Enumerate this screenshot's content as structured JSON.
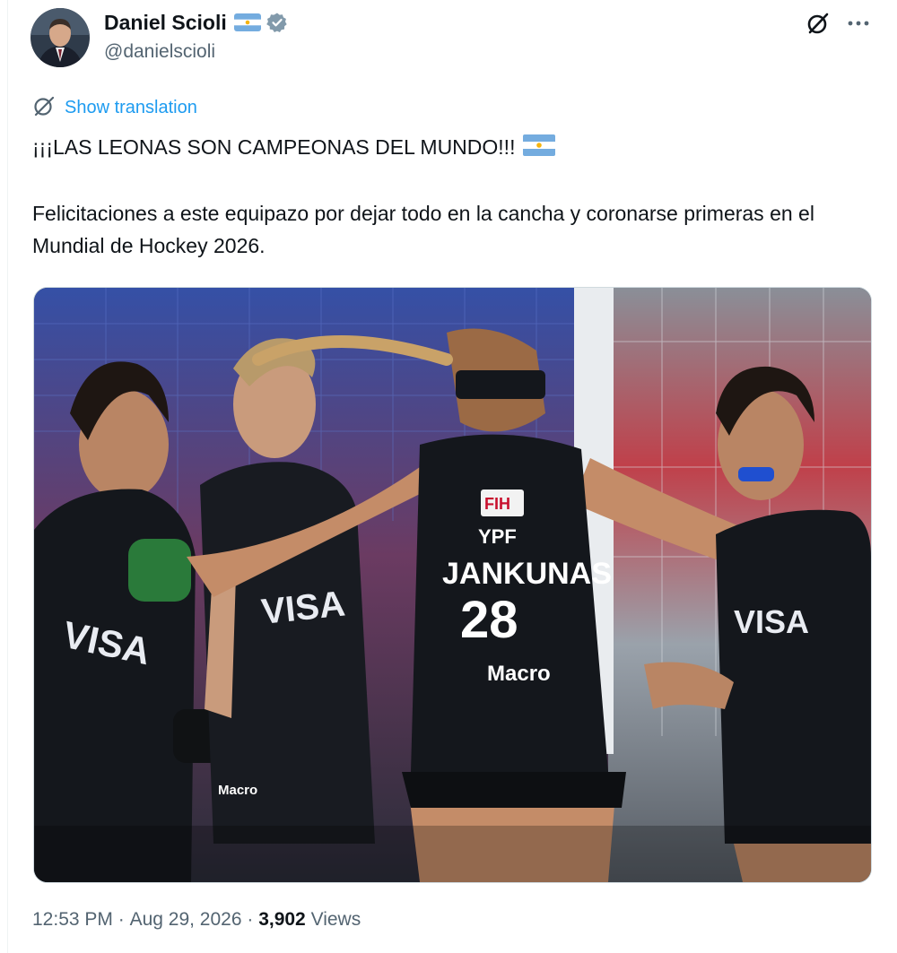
{
  "author": {
    "display_name": "Daniel Scioli",
    "handle": "@danielscioli"
  },
  "icons": {
    "flag": "argentina-flag-icon",
    "verified": "verified-badge-icon",
    "grok": "grok-icon",
    "more": "more-icon",
    "translate": "globe-icon"
  },
  "translation": {
    "label": "Show translation"
  },
  "tweet": {
    "line1": "¡¡¡LAS LEONAS SON CAMPEONAS DEL MUNDO!!! ",
    "line2": "Felicitaciones a este equipazo por dejar todo en la cancha y coronarse primeras en el Mundial de Hockey 2026."
  },
  "photo": {
    "jersey_sponsor": "YPF",
    "jersey_name": "JANKUNAS",
    "jersey_number": "28",
    "shirt_logo": "VISA",
    "short_sponsor": "Macro",
    "badge": "FIH"
  },
  "meta": {
    "time": "12:53 PM",
    "separator": " · ",
    "date": "Aug 29, 2026",
    "views_count": "3,902",
    "views_label": " Views"
  },
  "colors": {
    "accent": "#1d9bf0",
    "secondary_text": "#536471",
    "primary_text": "#0f1419"
  }
}
